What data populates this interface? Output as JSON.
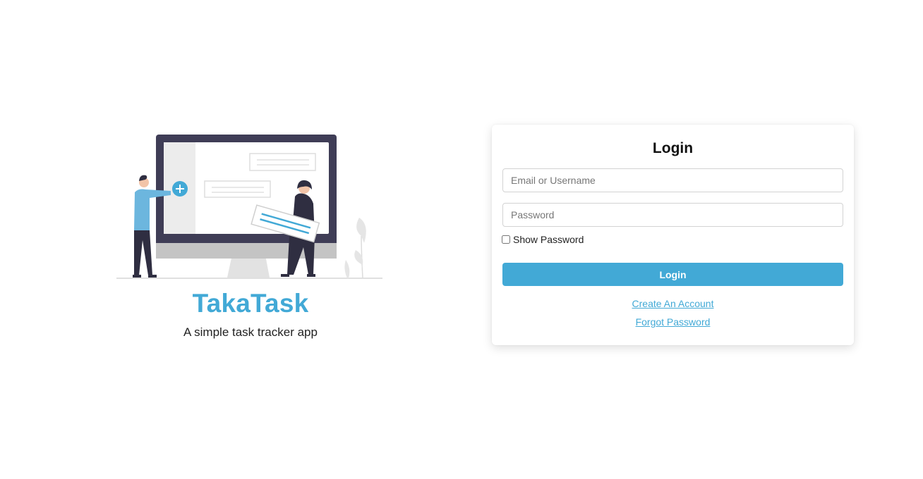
{
  "brand": {
    "name": "TakaTask",
    "tagline": "A simple task tracker app",
    "accent_color": "#42a9d6"
  },
  "login": {
    "title": "Login",
    "email_placeholder": "Email or Username",
    "email_value": "",
    "password_placeholder": "Password",
    "password_value": "",
    "show_password_label": "Show Password",
    "show_password_checked": false,
    "submit_label": "Login",
    "create_account_link": "Create An Account",
    "forgot_password_link": "Forgot Password"
  },
  "colors": {
    "accent": "#42a9d6",
    "monitor_frame": "#3f3d56",
    "text": "#222222"
  }
}
